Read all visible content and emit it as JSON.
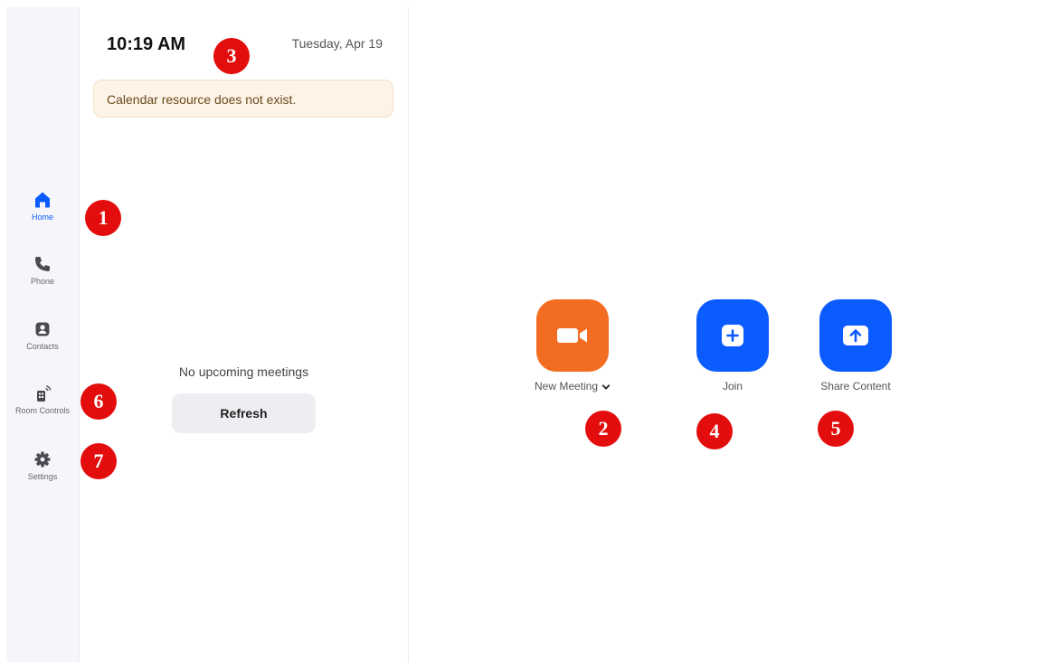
{
  "sidebar": {
    "items": [
      {
        "label": "Home",
        "icon": "home-icon",
        "active": true
      },
      {
        "label": "Phone",
        "icon": "phone-icon",
        "active": false
      },
      {
        "label": "Contacts",
        "icon": "contacts-icon",
        "active": false
      },
      {
        "label": "Room Controls",
        "icon": "room-controls-icon",
        "active": false
      },
      {
        "label": "Settings",
        "icon": "gear-icon",
        "active": false
      }
    ]
  },
  "header": {
    "time": "10:19 AM",
    "date": "Tuesday, Apr 19"
  },
  "banner": {
    "message": "Calendar resource does not exist."
  },
  "meetings": {
    "empty_text": "No upcoming meetings",
    "refresh_label": "Refresh"
  },
  "actions": [
    {
      "label": "New Meeting",
      "icon": "video-camera-icon",
      "color": "#f26d21"
    },
    {
      "label": "Join",
      "icon": "plus-icon",
      "color": "#0b5cff"
    },
    {
      "label": "Share Content",
      "icon": "upload-arrow-icon",
      "color": "#0b5cff"
    }
  ],
  "markers": [
    "1",
    "2",
    "3",
    "4",
    "5",
    "6",
    "7"
  ],
  "colors": {
    "accent": "#0b5cff",
    "new_meeting": "#f26d21",
    "marker": "#e30d0d",
    "sidebar_bg": "#f6f6fa",
    "banner_bg": "#fdf3e7"
  }
}
